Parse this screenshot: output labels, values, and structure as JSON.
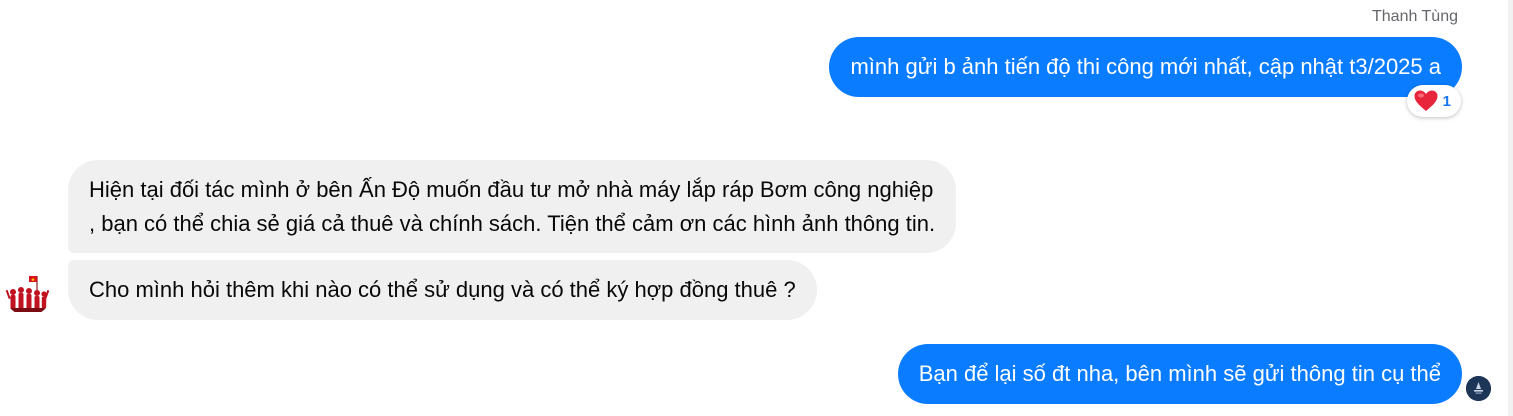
{
  "conversation": {
    "sender_name": "Thanh Tùng",
    "messages": [
      {
        "direction": "outgoing",
        "lines": [
          "mình gửi b ảnh tiến độ thi công mới nhất, cập nhật t3/2025 a"
        ],
        "reaction": {
          "icon": "heart-icon",
          "count": "1"
        }
      },
      {
        "direction": "incoming",
        "lines": [
          "Hiện tại đối tác mình ở bên Ấn Độ muốn đầu tư mở nhà máy lắp ráp Bơm công nghiệp",
          ", bạn có thể chia sẻ giá cả thuê và chính sách. Tiện thể cảm ơn các hình ảnh thông tin."
        ]
      },
      {
        "direction": "incoming",
        "lines": [
          "Cho mình hỏi thêm khi nào có thể sử dụng và có thể ký hợp đồng thuê ?"
        ]
      },
      {
        "direction": "outgoing",
        "lines": [
          "Bạn để lại số đt nha, bên mình sẽ gửi thông tin cụ thể"
        ]
      }
    ]
  },
  "colors": {
    "outgoing_bubble": "#0a7cff",
    "incoming_bubble": "#f0f0f0",
    "reaction_heart": "#e8263b",
    "reaction_count": "#1877f2"
  },
  "icons": {
    "reaction": "heart-icon",
    "contact_avatar": "contact-avatar-icon",
    "seen_indicator": "seen-avatar-icon"
  }
}
